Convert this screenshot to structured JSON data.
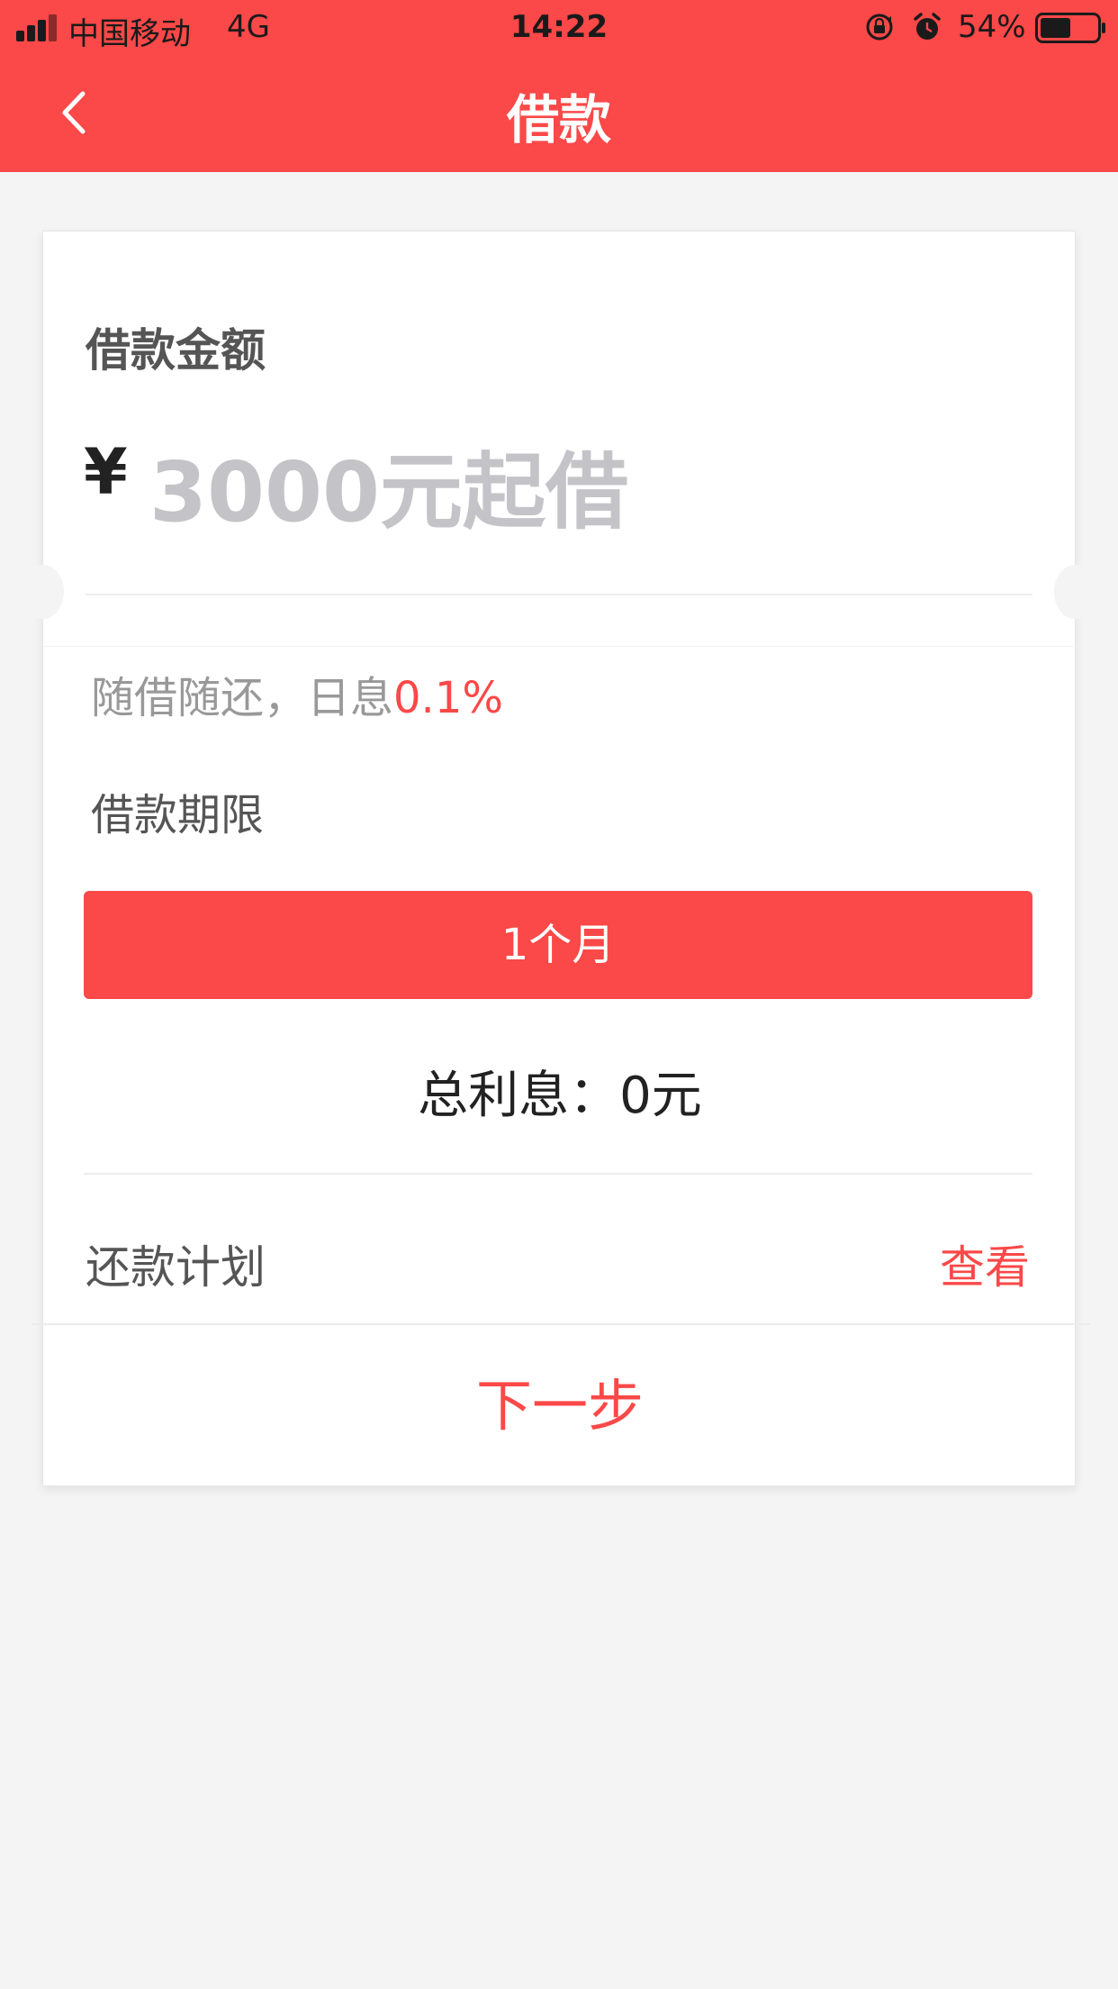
{
  "status_bar": {
    "carrier": "中国移动",
    "network": "4G",
    "time": "14:22",
    "battery_percent": "54%",
    "battery_level": 0.54
  },
  "nav": {
    "title": "借款",
    "back_icon": "chevron-left-icon"
  },
  "loan_form": {
    "amount_label": "借款金额",
    "currency_symbol": "¥",
    "amount_placeholder": "3000元起借",
    "amount_value": "",
    "rate_text": "随借随还，日息",
    "rate_value": "0.1%",
    "term_label": "借款期限",
    "term_option": "1个月",
    "interest_label": "总利息：",
    "interest_value": "0元",
    "repayment_plan_label": "还款计划",
    "repayment_plan_link": "查看",
    "next_button": "下一步"
  },
  "colors": {
    "accent": "#fb4848",
    "background": "#f4f4f4",
    "placeholder": "#c4c4c8"
  }
}
